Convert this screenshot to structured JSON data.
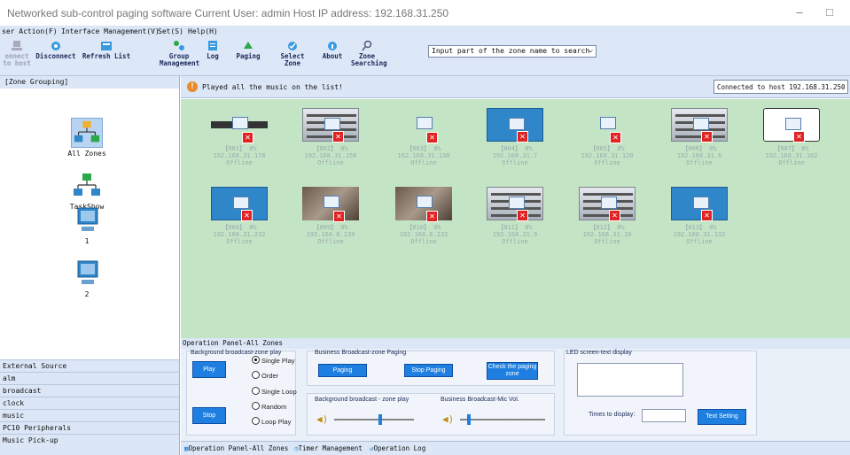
{
  "window": {
    "title": "Networked sub-control paging software Current User: admin   Host IP address: 192.168.31.250",
    "minimize": "–",
    "maximize": "□"
  },
  "menu": [
    "ser Action(F)",
    "Interface Management(V)",
    "Set(S)",
    "Help(H)"
  ],
  "toolbar": {
    "connect_label": "onnect to host",
    "disconnect_label": "Disconnect",
    "refresh_label": "Refresh List",
    "group_label": "Group Management",
    "log_label": "Log",
    "paging_label": "Paging",
    "select_zone_label": "Select Zone",
    "about_label": "About",
    "zone_search_label": "Zone Searching",
    "search_placeholder": "Input part of the zone name to search"
  },
  "left_panel": {
    "header": "[Zone Grouping]",
    "groups": [
      "All Zones",
      "TaskShow",
      "1",
      "2"
    ],
    "sections": [
      "External Source",
      "alm",
      "broadcast",
      "clock",
      "music",
      "PC10 Peripherals",
      "Music Pick-up"
    ]
  },
  "banner": {
    "message": "Played all the music on the list!",
    "connection": "Connected to host 192.168.31.250 !"
  },
  "zones": [
    {
      "id": "【001】",
      "vol": "0%",
      "ip": "192.168.31.178",
      "status": "Offline",
      "device": "strip"
    },
    {
      "id": "【002】",
      "vol": "0%",
      "ip": "192.168.31.156",
      "status": "Offline",
      "device": "rack"
    },
    {
      "id": "【003】",
      "vol": "0%",
      "ip": "192.168.31.130",
      "status": "Offline",
      "device": "small"
    },
    {
      "id": "【004】",
      "vol": "0%",
      "ip": "192.168.31.7",
      "status": "Offline",
      "device": "pc"
    },
    {
      "id": "【005】",
      "vol": "0%",
      "ip": "192.168.31.120",
      "status": "Offline",
      "device": "small"
    },
    {
      "id": "【006】",
      "vol": "0%",
      "ip": "192.168.31.6",
      "status": "Offline",
      "device": "rack"
    },
    {
      "id": "【007】",
      "vol": "0%",
      "ip": "192.168.31.102",
      "status": "Offline",
      "device": "panel"
    },
    {
      "id": "【008】",
      "vol": "0%",
      "ip": "192.168.31.232",
      "status": "Offline",
      "device": "pc"
    },
    {
      "id": "【009】",
      "vol": "0%",
      "ip": "192.168.8.139",
      "status": "Offline",
      "device": "photo"
    },
    {
      "id": "【010】",
      "vol": "0%",
      "ip": "192.168.8.232",
      "status": "Offline",
      "device": "photo"
    },
    {
      "id": "【011】",
      "vol": "0%",
      "ip": "192.168.31.9",
      "status": "Offline",
      "device": "rack"
    },
    {
      "id": "【012】",
      "vol": "0%",
      "ip": "192.168.31.10",
      "status": "Offline",
      "device": "rack"
    },
    {
      "id": "【013】",
      "vol": "0%",
      "ip": "192.168.31.132",
      "status": "Offline",
      "device": "pc"
    }
  ],
  "operation_panel": {
    "header": "Operation Panel-All Zones",
    "bg_title": "Background broadcast-zone play",
    "play": "Play",
    "stop": "Stop",
    "modes": [
      "Single Play",
      "Order",
      "Single Loop",
      "Random",
      "Loop Play"
    ],
    "selected_mode": "Single Play",
    "biz_title": "Business Broadcast-zone Paging",
    "paging": "Paging",
    "stop_paging": "Stop Paging",
    "check_paging": "Check the paging zone",
    "bg_vol_title": "Background broadcast - zone play",
    "mic_vol_title": "Business Broadcast-Mic Vol.",
    "bg_volume": 0.55,
    "mic_volume": 0.08,
    "led_title": "LED screen-text display",
    "times_label": "Times to display:",
    "text_setting": "Text Setting"
  },
  "status_tabs": [
    "Operation Panel-All Zones",
    "Timer Management",
    "Operation Log"
  ]
}
